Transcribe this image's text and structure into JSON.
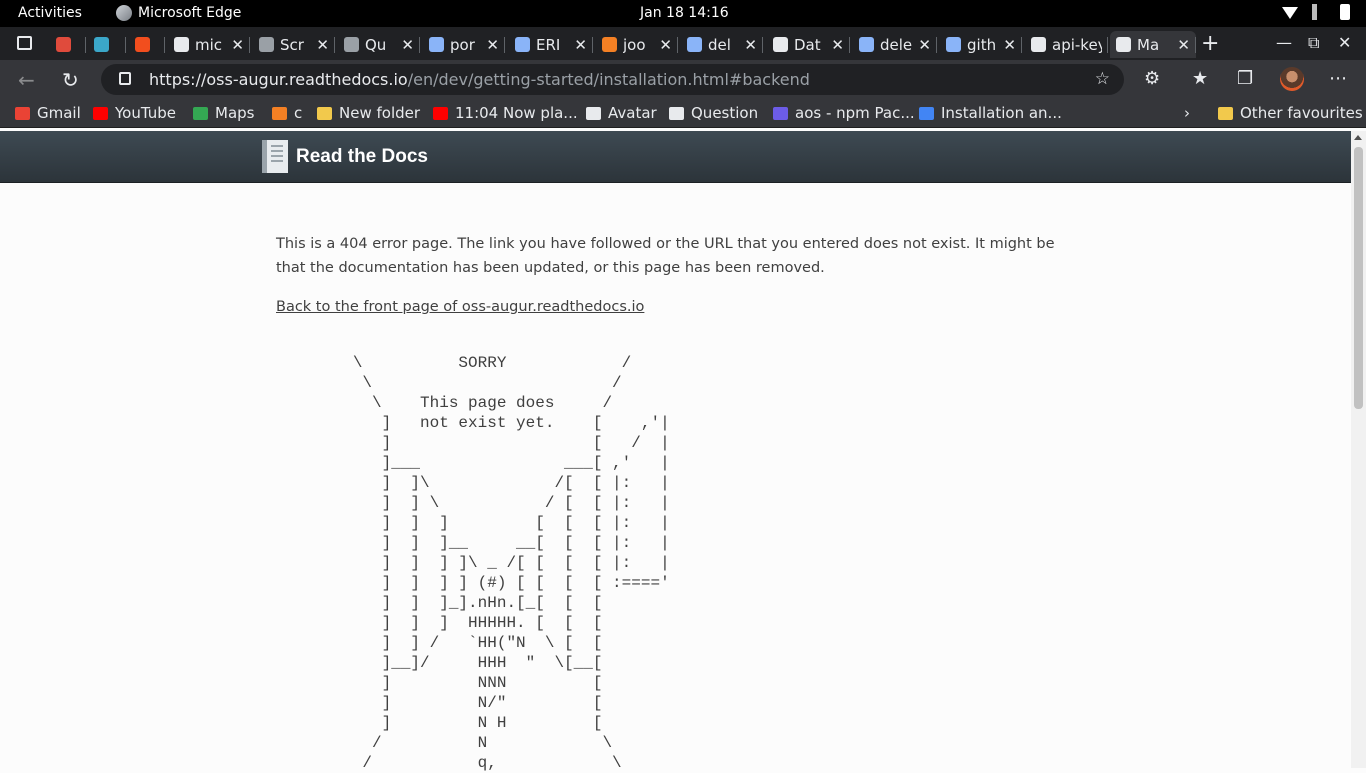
{
  "system_bar": {
    "activities": "Activities",
    "app_name": "Microsoft Edge",
    "clock": "Jan 18  14:16"
  },
  "tabs": [
    {
      "label": "",
      "color": "#e04b3c"
    },
    {
      "label": "",
      "color": "#3ba7c9"
    },
    {
      "label": "",
      "color": "#f24e1e"
    },
    {
      "label": "mic",
      "color": "#e8eaed"
    },
    {
      "label": "Scr",
      "color": "#9aa0a6"
    },
    {
      "label": "Qu",
      "color": "#9aa0a6"
    },
    {
      "label": "por",
      "color": "#8ab4f8"
    },
    {
      "label": "ERI",
      "color": "#8ab4f8"
    },
    {
      "label": "joo",
      "color": "#f48024"
    },
    {
      "label": "del",
      "color": "#8ab4f8"
    },
    {
      "label": "Dat",
      "color": "#e8eaed"
    },
    {
      "label": "delete",
      "color": "#8ab4f8"
    },
    {
      "label": "github",
      "color": "#8ab4f8"
    },
    {
      "label": "api-key",
      "color": "#e8eaed"
    },
    {
      "label": "Ma",
      "color": "#e8eaed",
      "active": true
    }
  ],
  "address_bar": {
    "url_host": "https://oss-augur.readthedocs.io",
    "url_path": "/en/dev/getting-started/installation.html#backend"
  },
  "bookmarks": [
    {
      "label": "Gmail",
      "color": "#ea4335"
    },
    {
      "label": "YouTube",
      "color": "#ff0000"
    },
    {
      "label": "Maps",
      "color": "#34a853"
    },
    {
      "label": "c",
      "color": "#f48024"
    },
    {
      "label": "New folder",
      "color": "#f2c94c"
    },
    {
      "label": "11:04 Now pla...",
      "color": "#ff0000"
    },
    {
      "label": "Avatar",
      "color": "#e8eaed"
    },
    {
      "label": "Question",
      "color": "#e8eaed"
    },
    {
      "label": "aos - npm Pac...",
      "color": "#6c5ce7"
    },
    {
      "label": "Installation an...",
      "color": "#4285f4"
    },
    {
      "label": "Other favourites",
      "color": "#f2c94c"
    }
  ],
  "page": {
    "brand": "Read the Docs",
    "message": "This is a 404 error page. The link you have followed or the URL that you entered does not exist. It might be that the documentation has been updated, or this page has been removed.",
    "back_link": "Back to the front page of oss-augur.readthedocs.io",
    "ascii_art": "        \\          SORRY            /\n         \\                         /\n          \\    This page does     /\n           ]   not exist yet.    [    ,'|\n           ]                     [   /  |\n           ]___               ___[ ,'   |\n           ]  ]\\             /[  [ |:   |\n           ]  ] \\           / [  [ |:   |\n           ]  ]  ]         [  [  [ |:   |\n           ]  ]  ]__     __[  [  [ |:   |\n           ]  ]  ] ]\\ _ /[ [  [  [ |:   |\n           ]  ]  ] ] (#) [ [  [  [ :====' \n           ]  ]  ]_].nHn.[_[  [  [\n           ]  ]  ]  HHHHH. [  [  [\n           ]  ] /   `HH(\"N  \\ [  [\n           ]__]/     HHH  \"  \\[__[\n           ]         NNN         [\n           ]         N/\"         [\n           ]         N H         [\n          /          N            \\\n         /           q,            \\"
  }
}
